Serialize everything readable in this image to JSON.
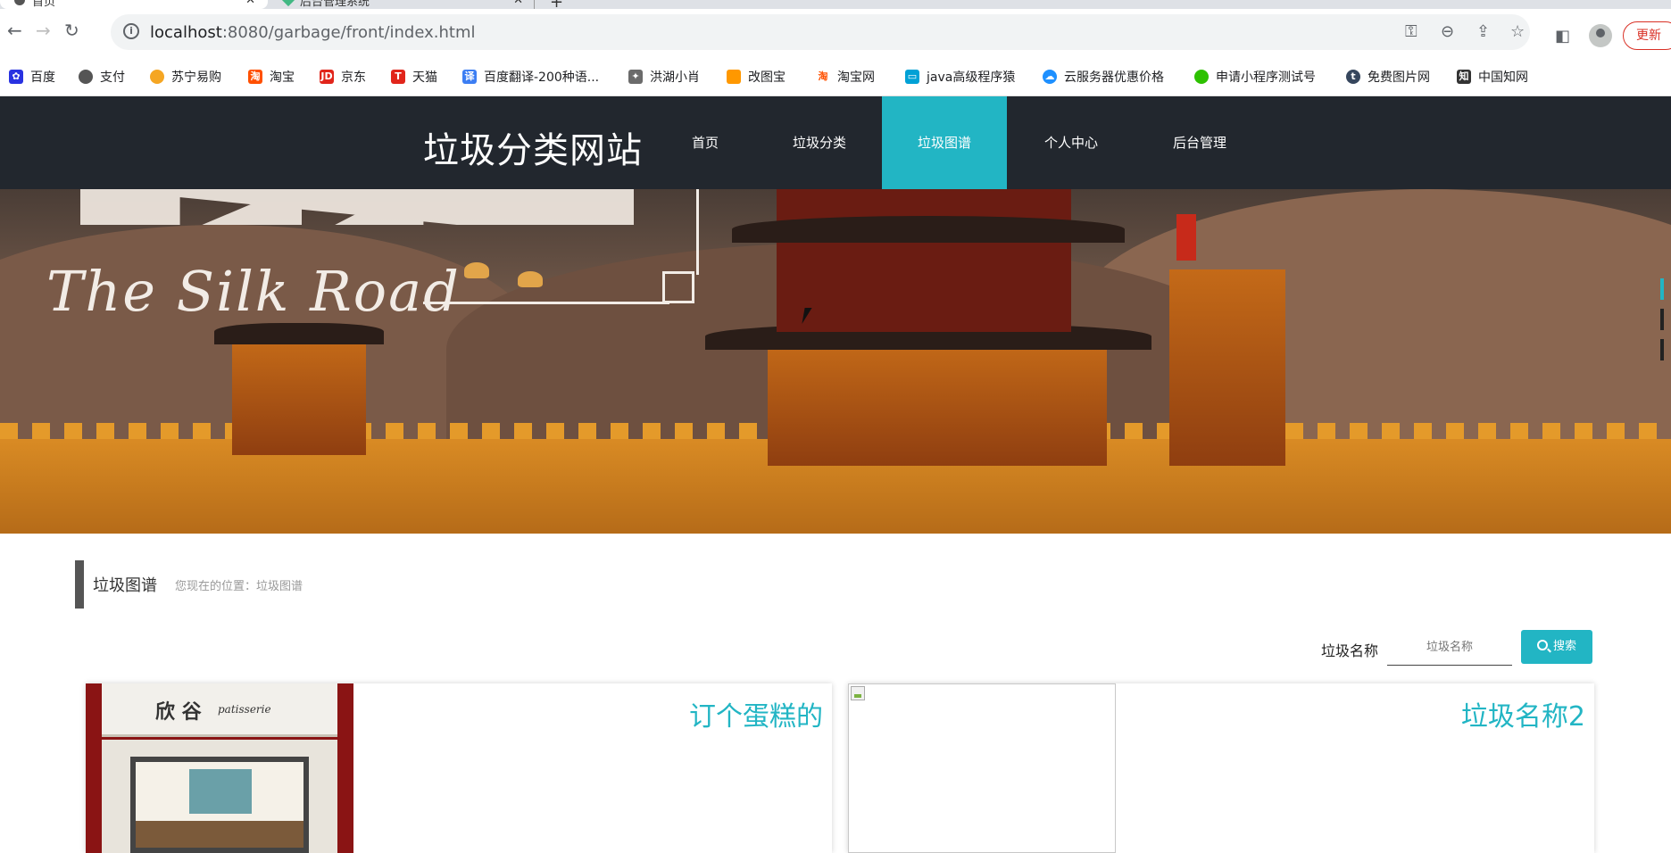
{
  "browser": {
    "tabs": [
      {
        "title": "首页",
        "active": true
      },
      {
        "title": "后台管理系统",
        "active": false
      }
    ],
    "url_host": "localhost",
    "url_path": ":8080/garbage/front/index.html",
    "update_label": "更新",
    "bookmarks": [
      {
        "label": "百度",
        "icon": "baidu-icon",
        "color": "#2932e1"
      },
      {
        "label": "支付",
        "icon": "globe-icon",
        "color": "#555555"
      },
      {
        "label": "苏宁易购",
        "icon": "lion-icon",
        "color": "#f5a623"
      },
      {
        "label": "淘宝",
        "icon": "taobao-icon",
        "color": "#ff5000"
      },
      {
        "label": "京东",
        "icon": "jd-icon",
        "color": "#e1251b"
      },
      {
        "label": "天猫",
        "icon": "tmall-icon",
        "color": "#e1251b"
      },
      {
        "label": "百度翻译-200种语...",
        "icon": "translate-icon",
        "color": "#3c7ef3"
      },
      {
        "label": "洪湖小肖",
        "icon": "bird-icon",
        "color": "#6b6b6b"
      },
      {
        "label": "改图宝",
        "icon": "image-edit-icon",
        "color": "#ff9800"
      },
      {
        "label": "淘宝网",
        "icon": "taobao-icon",
        "color": "#ff5000"
      },
      {
        "label": "java高级程序猿",
        "icon": "bilibili-icon",
        "color": "#00a1d6"
      },
      {
        "label": "云服务器优惠价格",
        "icon": "cloud-icon",
        "color": "#1e90ff"
      },
      {
        "label": "申请小程序测试号",
        "icon": "wechat-icon",
        "color": "#2dc100"
      },
      {
        "label": "免费图片网",
        "icon": "tumblr-icon",
        "color": "#36465d"
      },
      {
        "label": "中国知网",
        "icon": "cnki-icon",
        "color": "#333333"
      }
    ]
  },
  "site": {
    "title": "垃圾分类网站",
    "nav": [
      {
        "label": "首页",
        "active": false
      },
      {
        "label": "垃圾分类",
        "active": false
      },
      {
        "label": "垃圾图谱",
        "active": true
      },
      {
        "label": "个人中心",
        "active": false
      },
      {
        "label": "后台管理",
        "active": false
      }
    ],
    "accent_color": "#22b5c4",
    "header_color": "#22272e"
  },
  "banner": {
    "text": "The Silk Road"
  },
  "section": {
    "title": "垃圾图谱",
    "breadcrumb_prefix": "您现在的位置：",
    "breadcrumb_current": "垃圾图谱"
  },
  "search": {
    "label": "垃圾名称",
    "placeholder": "垃圾名称",
    "button_label": "搜索"
  },
  "cards": [
    {
      "title": "订个蛋糕的",
      "image": "shop-photo",
      "sign_text": "欣 谷",
      "sign_sub": "patisserie"
    },
    {
      "title": "垃圾名称2",
      "image": "broken-image"
    }
  ]
}
